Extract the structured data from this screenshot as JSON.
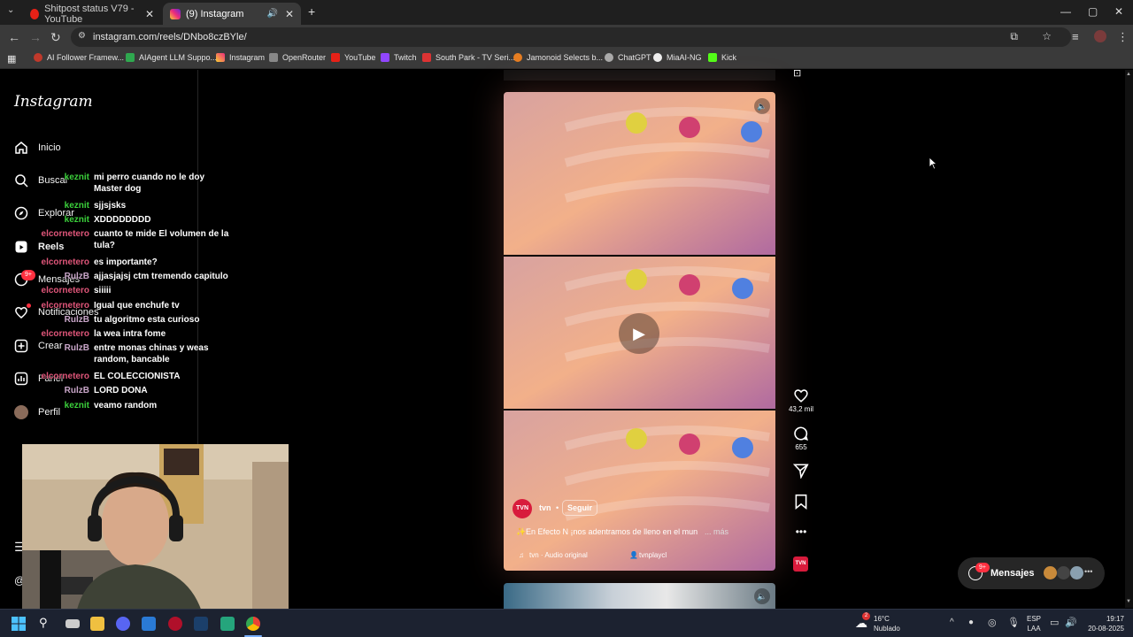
{
  "browser": {
    "tabs": [
      {
        "title": "Shitpost status V79 - YouTube",
        "active": false
      },
      {
        "title": "(9) Instagram",
        "active": true
      }
    ],
    "url": "instagram.com/reels/DNbo8czBYle/",
    "bookmarks": [
      "AI Follower Framew...",
      "AIAgent LLM Suppo...",
      "Instagram",
      "OpenRouter",
      "YouTube",
      "Twitch",
      "South Park - TV Seri...",
      "Jamonoid Selects b...",
      "ChatGPT",
      "MiaAI-NG",
      "Kick"
    ]
  },
  "instagram": {
    "logo": "Instagram",
    "nav": [
      {
        "label": "Inicio",
        "icon": "home-icon"
      },
      {
        "label": "Buscar",
        "icon": "search-icon"
      },
      {
        "label": "Explorar",
        "icon": "compass-icon"
      },
      {
        "label": "Reels",
        "icon": "reels-icon"
      },
      {
        "label": "Mensajes",
        "icon": "messenger-icon",
        "badge": "9+"
      },
      {
        "label": "Notificaciones",
        "icon": "heart-icon"
      },
      {
        "label": "Crear",
        "icon": "plus-square-icon"
      },
      {
        "label": "Panel",
        "icon": "chart-icon"
      },
      {
        "label": "Perfil",
        "icon": "avatar-icon"
      }
    ]
  },
  "chat": [
    {
      "user": "keznit",
      "color": "#3bd13b",
      "msg": "mi perro cuando no le doy Master dog"
    },
    {
      "user": "keznit",
      "color": "#3bd13b",
      "msg": "sjjsjsks"
    },
    {
      "user": "keznit",
      "color": "#3bd13b",
      "msg": "XDDDDDDDD"
    },
    {
      "user": "elcornetero",
      "color": "#e0567a",
      "msg": "cuanto te mide El volumen de la tula?"
    },
    {
      "user": "elcornetero",
      "color": "#e0567a",
      "msg": "es importante?"
    },
    {
      "user": "RulzB",
      "color": "#c9a6c9",
      "msg": "ajjasjajsj ctm tremendo capitulo"
    },
    {
      "user": "elcornetero",
      "color": "#e0567a",
      "msg": "siiiii"
    },
    {
      "user": "elcornetero",
      "color": "#e0567a",
      "msg": "Igual que enchufe tv"
    },
    {
      "user": "RulzB",
      "color": "#c9a6c9",
      "msg": "tu algoritmo esta curioso"
    },
    {
      "user": "elcornetero",
      "color": "#e0567a",
      "msg": "la wea intra fome"
    },
    {
      "user": "RulzB",
      "color": "#c9a6c9",
      "msg": "entre monas chinas y weas random, bancable"
    },
    {
      "user": "elcornetero",
      "color": "#e0567a",
      "msg": "EL COLECCIONISTA"
    },
    {
      "user": "RulzB",
      "color": "#c9a6c9",
      "msg": "LORD DONA"
    },
    {
      "user": "keznit",
      "color": "#3bd13b",
      "msg": "veamo random"
    }
  ],
  "reel": {
    "account": "tvn",
    "account_badge": "TVN",
    "follow": "Seguir",
    "caption": "En Efecto N  ¡nos adentramos de lleno en el mun",
    "more": "... más",
    "audio": "tvn · Audio original",
    "tagged": "tvnplaycl",
    "likes": "43,2 mil",
    "comments": "655"
  },
  "messages_pill": {
    "label": "Mensajes",
    "badge": "9+"
  },
  "taskbar": {
    "weather_temp": "16°C",
    "weather_desc": "Nublado",
    "lang_top": "ESP",
    "lang_bottom": "LAA",
    "time": "19:17",
    "date": "20-08-2025",
    "weather_badge": "2"
  }
}
